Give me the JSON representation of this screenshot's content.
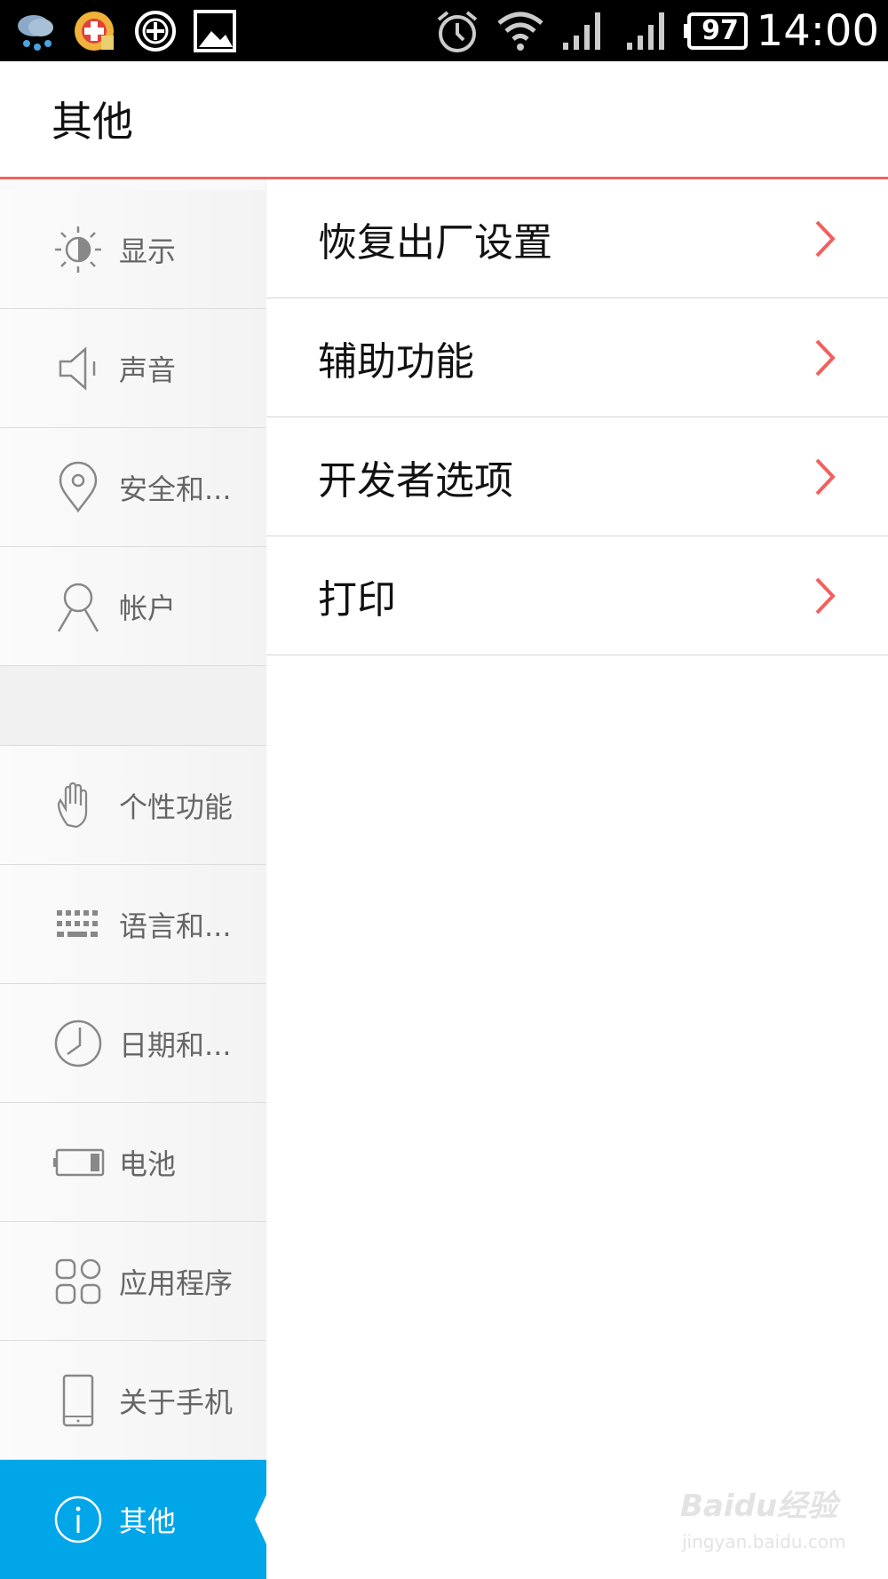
{
  "status_bar": {
    "battery": "97",
    "time": "14:00",
    "icons": [
      "weather-rain-icon",
      "app-notification-icon",
      "add-circle-icon",
      "image-icon",
      "alarm-icon",
      "wifi-icon",
      "signal-icon",
      "signal-icon",
      "battery-icon"
    ]
  },
  "header": {
    "title": "其他"
  },
  "sidebar": {
    "items": [
      {
        "label": "显示",
        "icon": "brightness-icon"
      },
      {
        "label": "声音",
        "icon": "speaker-icon"
      },
      {
        "label": "安全和...",
        "icon": "location-pin-icon"
      },
      {
        "label": "帐户",
        "icon": "person-icon"
      },
      {
        "label": "个性功能",
        "icon": "hand-icon"
      },
      {
        "label": "语言和...",
        "icon": "keyboard-icon"
      },
      {
        "label": "日期和...",
        "icon": "clock-icon"
      },
      {
        "label": "电池",
        "icon": "battery-icon"
      },
      {
        "label": "应用程序",
        "icon": "apps-grid-icon"
      },
      {
        "label": "关于手机",
        "icon": "phone-icon"
      },
      {
        "label": "其他",
        "icon": "info-icon",
        "active": true
      }
    ]
  },
  "content": {
    "items": [
      {
        "label": "恢复出厂设置"
      },
      {
        "label": "辅助功能"
      },
      {
        "label": "开发者选项"
      },
      {
        "label": "打印"
      }
    ]
  },
  "watermark": {
    "line1": "Baidu经验",
    "line2": "jingyan.baidu.com"
  },
  "colors": {
    "accent": "#f2605e",
    "active": "#00a6e8",
    "status_bar": "#000000"
  }
}
